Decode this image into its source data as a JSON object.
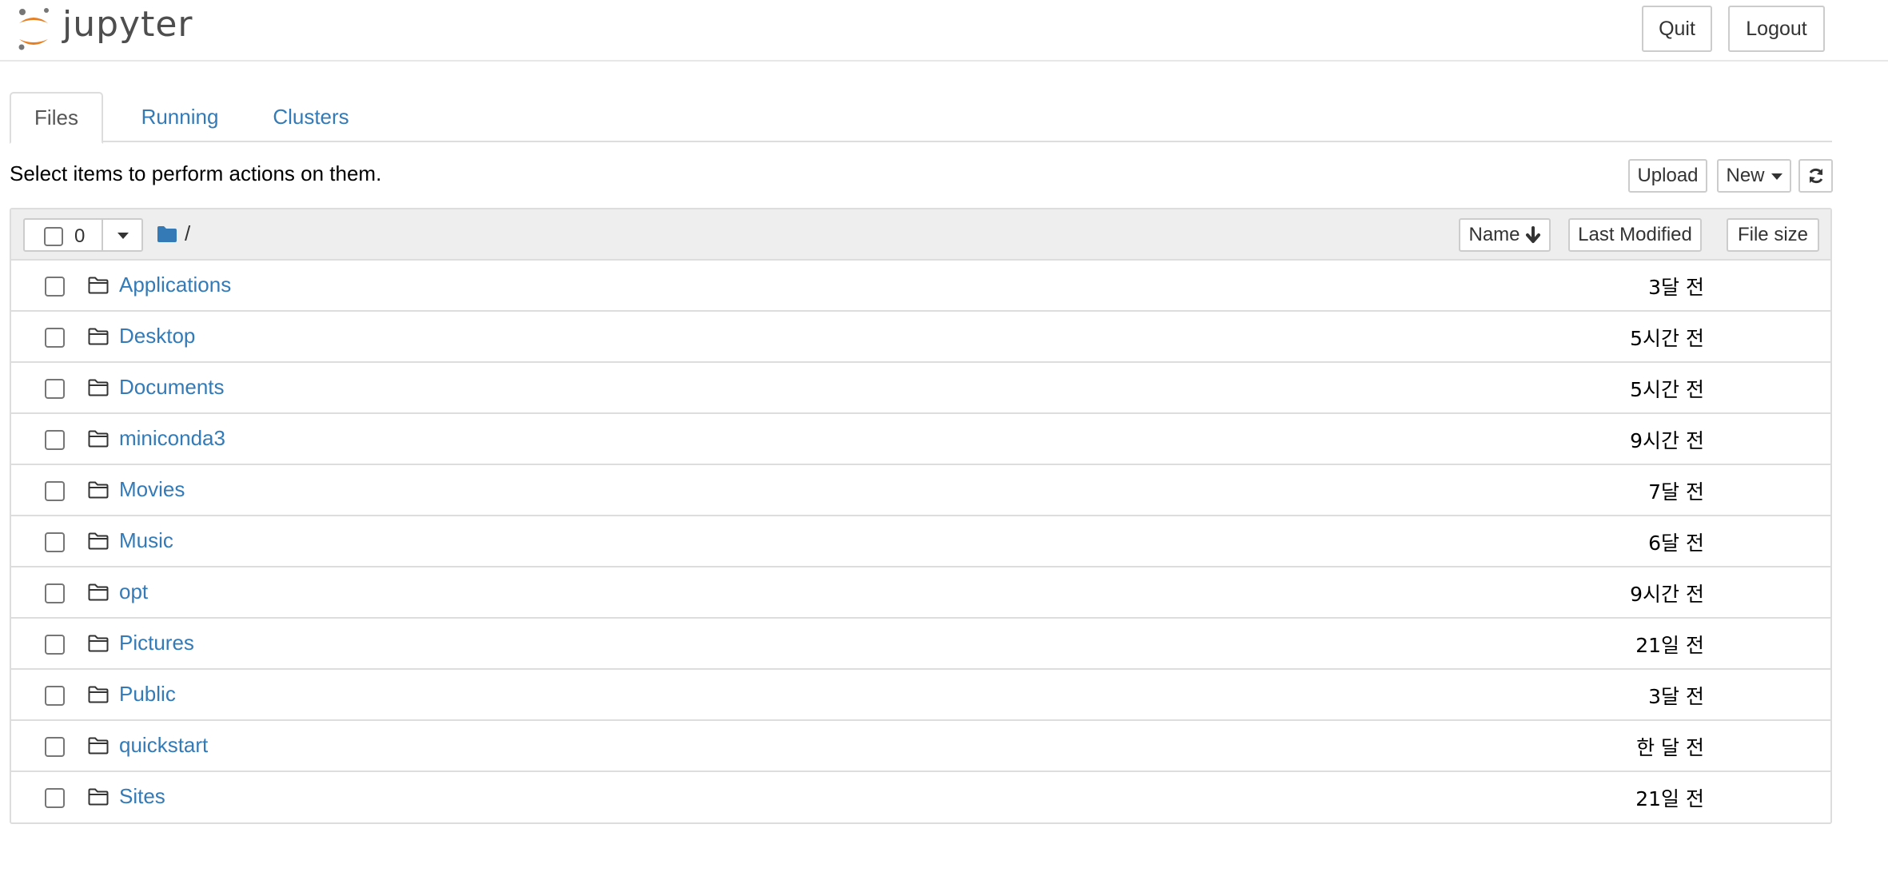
{
  "header": {
    "logo_text": "jupyter",
    "quit_label": "Quit",
    "logout_label": "Logout"
  },
  "tabs": [
    {
      "label": "Files",
      "active": true
    },
    {
      "label": "Running",
      "active": false
    },
    {
      "label": "Clusters",
      "active": false
    }
  ],
  "toolbar": {
    "instructions": "Select items to perform actions on them.",
    "upload_label": "Upload",
    "new_label": "New",
    "refresh_icon": "refresh-icon"
  },
  "list_header": {
    "selected_count": "0",
    "breadcrumb": "/",
    "sort_name_label": "Name",
    "sort_modified_label": "Last Modified",
    "sort_size_label": "File size"
  },
  "files": [
    {
      "name": "Applications",
      "modified": "3달 전",
      "icon": "folder-icon"
    },
    {
      "name": "Desktop",
      "modified": "5시간 전",
      "icon": "folder-icon"
    },
    {
      "name": "Documents",
      "modified": "5시간 전",
      "icon": "folder-icon"
    },
    {
      "name": "miniconda3",
      "modified": "9시간 전",
      "icon": "folder-icon"
    },
    {
      "name": "Movies",
      "modified": "7달 전",
      "icon": "folder-icon"
    },
    {
      "name": "Music",
      "modified": "6달 전",
      "icon": "folder-icon"
    },
    {
      "name": "opt",
      "modified": "9시간 전",
      "icon": "folder-icon"
    },
    {
      "name": "Pictures",
      "modified": "21일 전",
      "icon": "folder-icon"
    },
    {
      "name": "Public",
      "modified": "3달 전",
      "icon": "folder-icon"
    },
    {
      "name": "quickstart",
      "modified": "한 달 전",
      "icon": "folder-icon"
    },
    {
      "name": "Sites",
      "modified": "21일 전",
      "icon": "folder-icon"
    }
  ],
  "colors": {
    "link": "#337ab7",
    "logo_orange": "#e67e22",
    "logo_gray": "#767677"
  }
}
